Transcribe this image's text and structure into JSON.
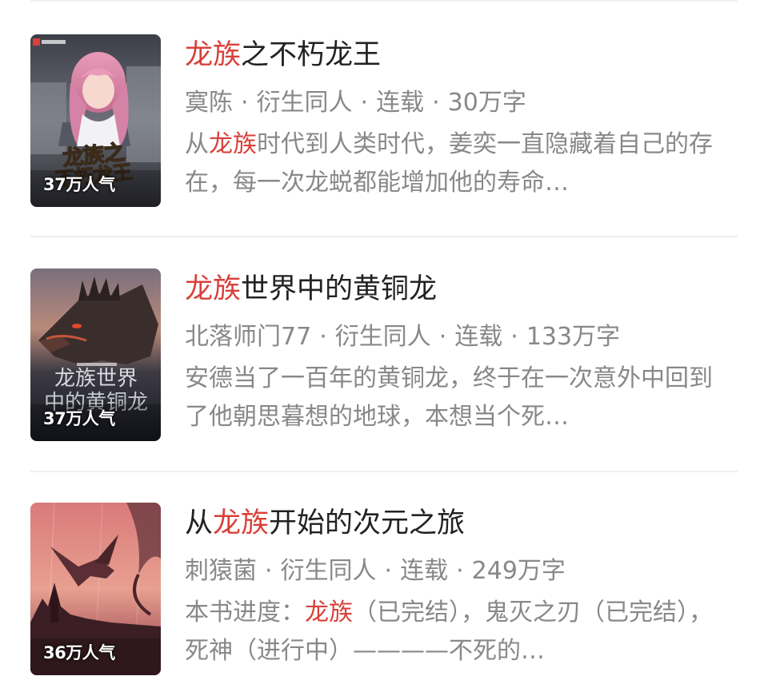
{
  "colors": {
    "highlight": "#d9403a",
    "title": "#222222",
    "meta": "#888888",
    "divider": "#efefef"
  },
  "books": [
    {
      "title_pre": "",
      "title_hl": "龙族",
      "title_post": "之不朽龙王",
      "author": "寞陈",
      "category": "衍生同人",
      "status": "连载",
      "words": "30万字",
      "desc_pre": "从",
      "desc_hl": "龙族",
      "desc_post": "时代到人类时代，姜奕一直隐藏着自己的存在，每一次龙蜕都能增加他的寿命…",
      "popularity": "37万人气",
      "cover_art_text": "龙族之不朽龙王",
      "cover_icon": "anime-girl-cover"
    },
    {
      "title_pre": "",
      "title_hl": "龙族",
      "title_post": "世界中的黄铜龙",
      "author": "北落师门77",
      "category": "衍生同人",
      "status": "连载",
      "words": "133万字",
      "desc_pre": "",
      "desc_hl": "",
      "desc_post": "安德当了一百年的黄铜龙，终于在一次意外中回到了他朝思暮想的地球，本想当个死…",
      "popularity": "37万人气",
      "cover_art_text": "龙族世界中的黄铜龙",
      "cover_icon": "dragon-cover"
    },
    {
      "title_pre": "从",
      "title_hl": "龙族",
      "title_post": "开始的次元之旅",
      "author": "刺猿菌",
      "category": "衍生同人",
      "status": "连载",
      "words": "249万字",
      "desc_pre": "本书进度：",
      "desc_hl": "龙族",
      "desc_post": "（已完结），鬼灭之刃（已完结），死神（进行中）————不死的…",
      "popularity": "36万人气",
      "cover_art_text": "",
      "cover_icon": "wyvern-sunset-cover"
    }
  ]
}
